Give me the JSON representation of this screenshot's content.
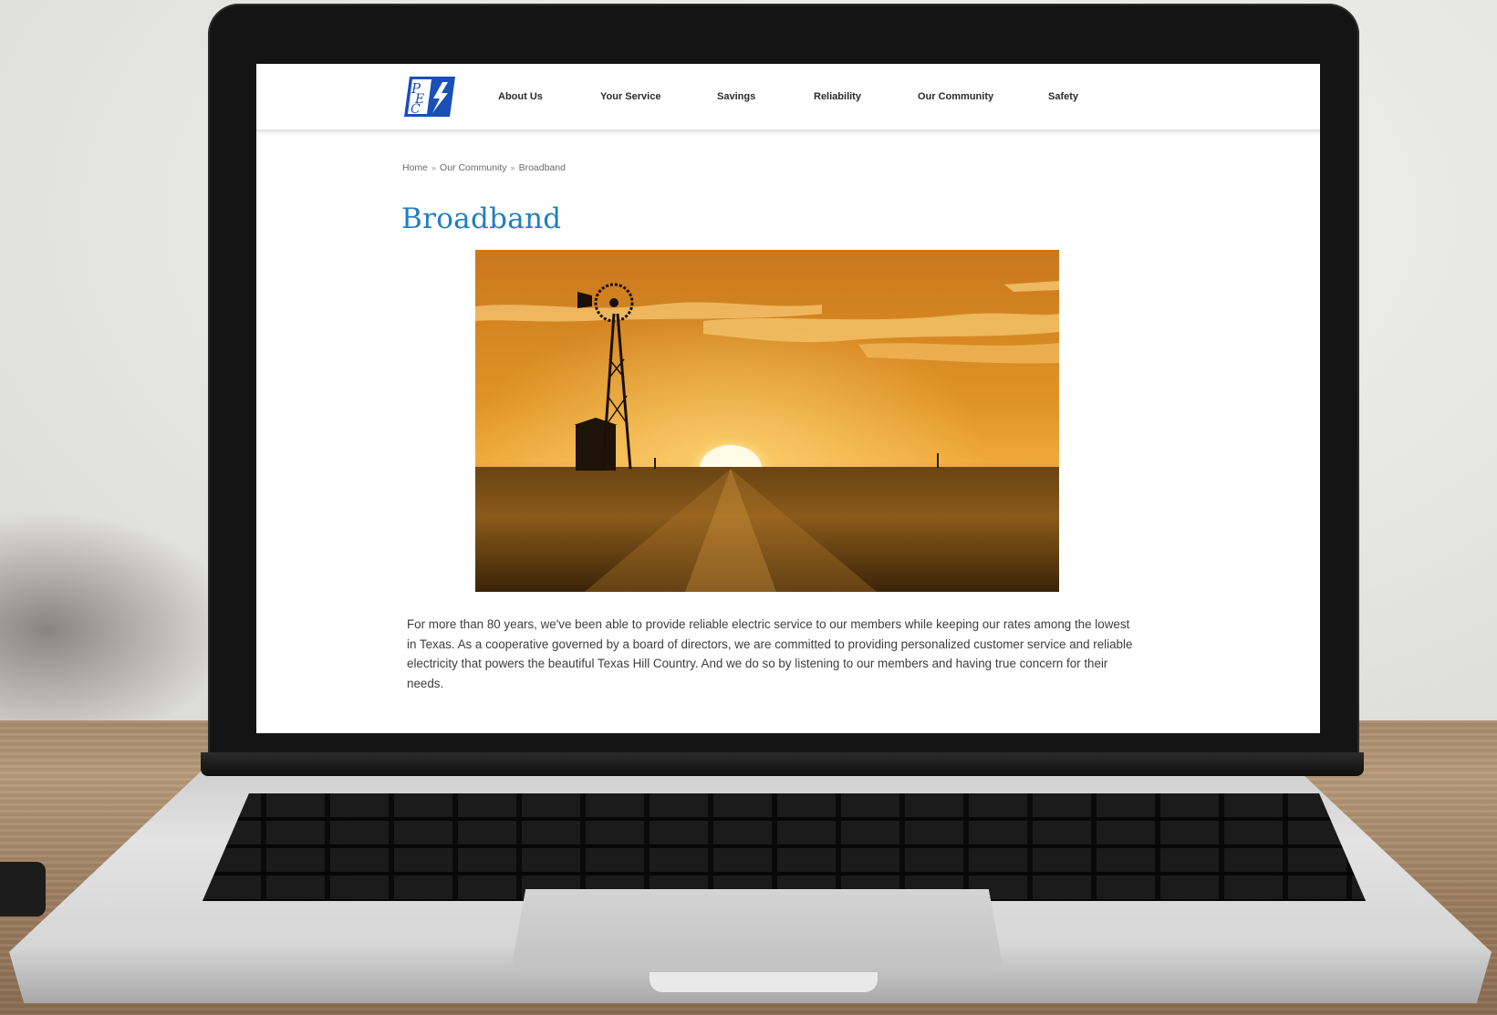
{
  "site": {
    "logo_text": "PEC",
    "nav": [
      "About Us",
      "Your Service",
      "Savings",
      "Reliability",
      "Our Community",
      "Safety"
    ]
  },
  "breadcrumb": {
    "items": [
      "Home",
      "Our Community",
      "Broadband"
    ],
    "separator": "»"
  },
  "page": {
    "title": "Broadband",
    "body": "For more than 80 years, we've been able to provide reliable electric service to our members while keeping our rates among the lowest in Texas. As a cooperative governed by a board of directors, we are committed to providing personalized customer service and reliable electricity that powers the beautiful Texas Hill Country. And we do so by listening to our members and having true concern for their needs."
  },
  "colors": {
    "brand_blue": "#1a4fb8",
    "title_blue": "#1f7fc0"
  }
}
